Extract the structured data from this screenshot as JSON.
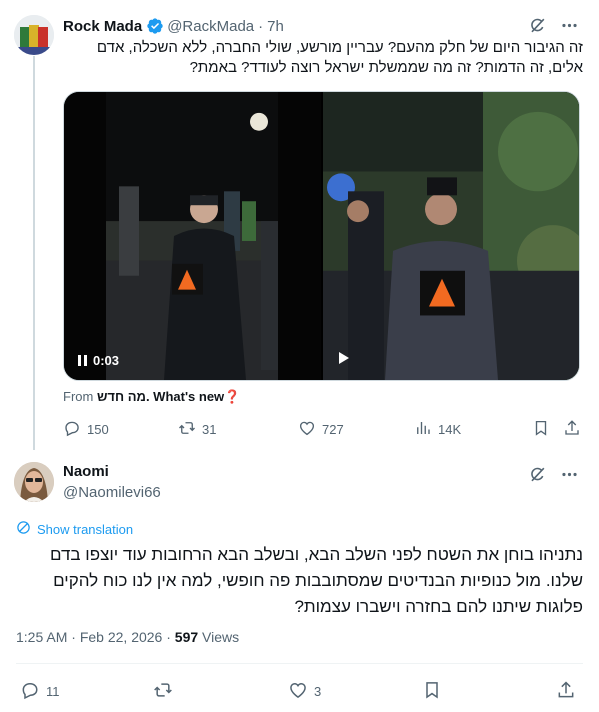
{
  "parent_tweet": {
    "name": "Rock Mada",
    "handle": "@RackMada",
    "time": "7h",
    "text": "זה הגיבור היום של חלק מהעם? עבריין מורשע, שולי החברה, ללא השכלה, אדם אלים, זה הדמות? זה מה שממשלת ישראל רוצה לעודד? באמת?",
    "video1_time": "0:03",
    "from_label": "From",
    "from_source": "מה חדש. What's new",
    "from_emoji": "❓",
    "replies": "150",
    "retweets": "31",
    "likes": "727",
    "views": "14K"
  },
  "main_tweet": {
    "name": "Naomi",
    "handle": "@Naomilevi66",
    "show_translation": "Show translation",
    "text": "נתניהו בוחן את השטח לפני השלב הבא, ובשלב הבא הרחובות עוד יוצפו בדם שלנו. מול כנופיות הבנדיטים שמסתובבות פה חופשי, למה אין לנו כוח להקים פלוגות שיתנו להם בחזרה וישברו עצמות?",
    "time": "1:25 AM",
    "date": "Feb 22, 2026",
    "views_count": "597",
    "views_label": "Views",
    "replies": "11",
    "likes": "3"
  },
  "colors": {
    "verified": "#1d9bf0",
    "link": "#1d9bf0",
    "muted": "#536471",
    "logo_orange": "#f26a21"
  },
  "icons": [
    "verified-badge-icon",
    "grok-icon",
    "more-icon",
    "reply-icon",
    "retweet-icon",
    "like-icon",
    "views-icon",
    "bookmark-icon",
    "share-icon",
    "translate-icon",
    "pause-icon",
    "play-icon"
  ]
}
